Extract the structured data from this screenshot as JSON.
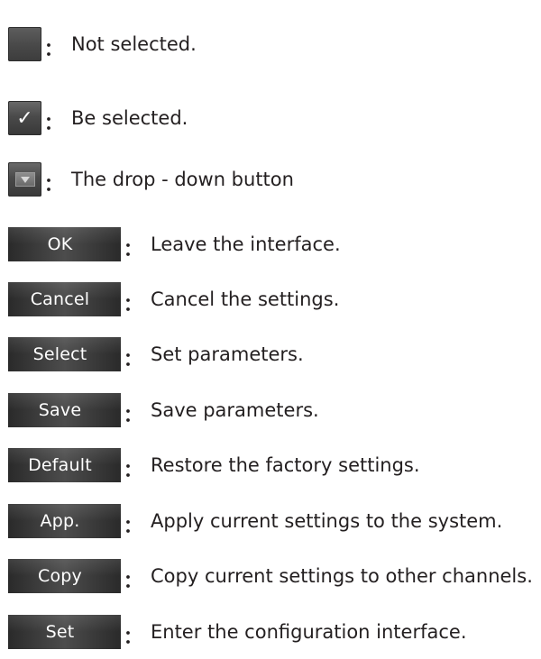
{
  "items": [
    {
      "icon": "empty-checkbox-icon",
      "desc": "Not selected.",
      "colon": "："
    },
    {
      "icon": "checked-checkbox-icon",
      "glyph": "✓",
      "desc": "Be selected.",
      "colon": "："
    },
    {
      "icon": "dropdown-arrow-icon",
      "desc": "The drop - down button",
      "colon": "："
    },
    {
      "button": "OK",
      "desc": "Leave the interface.",
      "colon": "："
    },
    {
      "button": "Cancel",
      "desc": "Cancel the settings.",
      "colon": "："
    },
    {
      "button": "Select",
      "desc": "Set parameters.",
      "colon": "："
    },
    {
      "button": "Save",
      "desc": "Save parameters.",
      "colon": "："
    },
    {
      "button": "Default",
      "desc": "Restore the factory settings.",
      "colon": "："
    },
    {
      "button": "App.",
      "desc": "Apply current settings to the system.",
      "colon": "："
    },
    {
      "button": "Copy",
      "desc": "Copy current settings to other channels.",
      "colon": "："
    },
    {
      "button": "Set",
      "desc": "Enter the configuration interface.",
      "colon": "："
    }
  ]
}
